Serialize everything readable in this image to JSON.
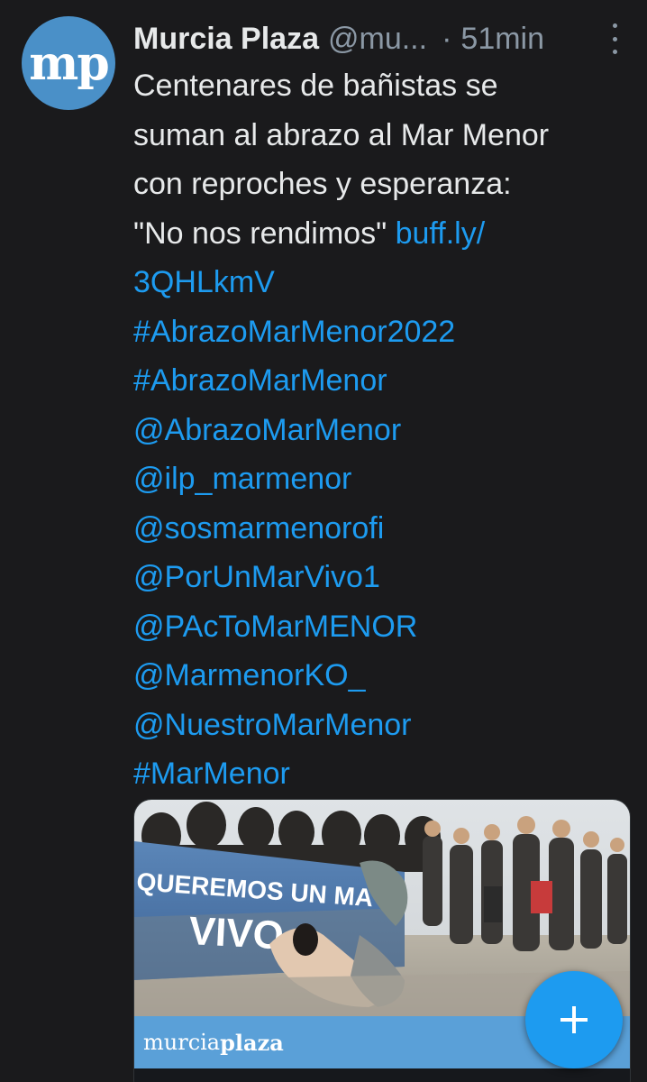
{
  "tweet": {
    "avatar_text": "mp",
    "author_name": "Murcia Plaza",
    "author_handle": "@mu...",
    "separator": "·",
    "time": "51min",
    "text_lines": [
      "Centenares de bañistas se",
      "suman al abrazo al Mar Menor",
      "con reproches y esperanza:"
    ],
    "text_last": "\"No nos rendimos\"",
    "link_part1": "buff.ly/",
    "link_part2": "3QHLkmV",
    "tags": [
      "#AbrazoMarMenor2022",
      "#AbrazoMarMenor",
      "@AbrazoMarMenor",
      "@ilp_marmenor",
      "@sosmarmenorofi",
      "@PorUnMarVivo1",
      "@PAcToMarMENOR",
      "@MarmenorKO_",
      "@NuestroMarMenor",
      "#MarMenor"
    ]
  },
  "card": {
    "banner_line1": "QUEREMOS UN MA",
    "banner_line2": "VIVO",
    "brand_part1": "murcia",
    "brand_part2": "plaza"
  },
  "icons": {
    "more": "more-vertical-icon",
    "compose": "plus-icon"
  },
  "colors": {
    "background": "#1a1a1c",
    "text": "#e7e9ea",
    "secondary": "#8b98a5",
    "link": "#1d9bf0",
    "avatar": "#4a90c8",
    "brand_bar": "#5aa0d8",
    "fab": "#1d9bf0"
  }
}
